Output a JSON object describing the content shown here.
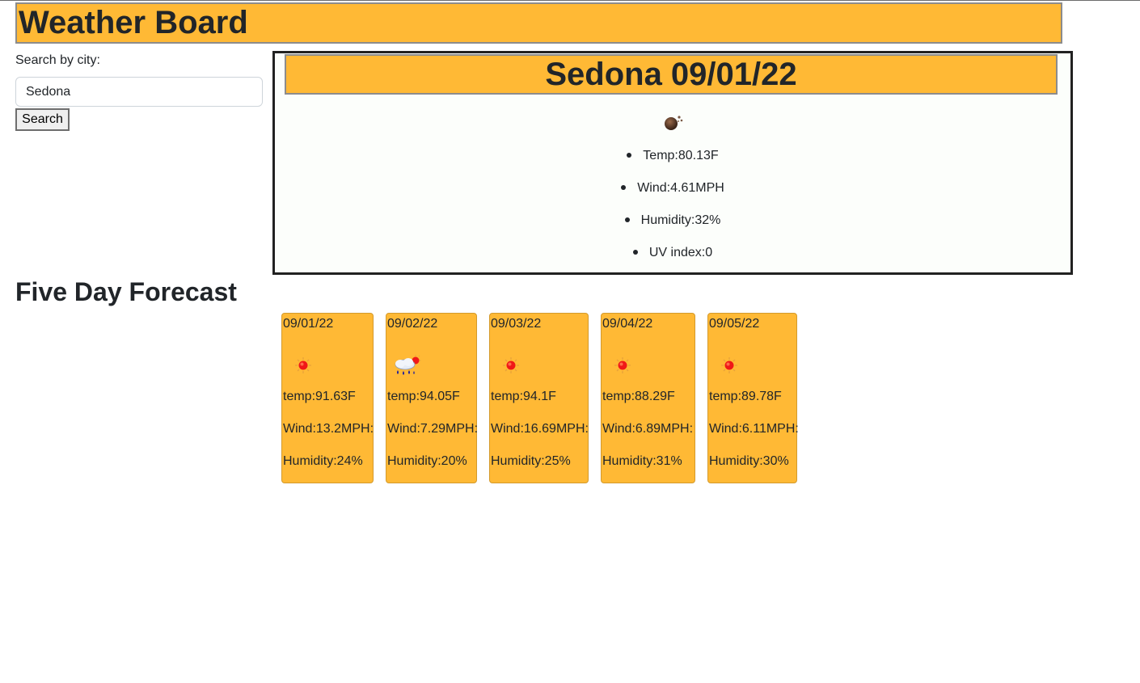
{
  "app": {
    "title": "Weather Board"
  },
  "search": {
    "label": "Search by city:",
    "value": "Sedona",
    "button_label": "Search"
  },
  "current": {
    "title": "Sedona 09/01/22",
    "icon": "smoke-icon",
    "items": [
      {
        "text": "Temp:80.13F"
      },
      {
        "text": "Wind:4.61MPH"
      },
      {
        "text": "Humidity:32%"
      },
      {
        "text": "UV index:0"
      }
    ]
  },
  "forecast": {
    "title": "Five Day Forecast",
    "days": [
      {
        "date": "09/01/22",
        "icon": "sun-icon",
        "temp": "temp:91.63F",
        "wind": "Wind:13.2MPH:",
        "humidity": "Humidity:24%"
      },
      {
        "date": "09/02/22",
        "icon": "rain-cloud-icon",
        "temp": "temp:94.05F",
        "wind": "Wind:7.29MPH:",
        "humidity": "Humidity:20%"
      },
      {
        "date": "09/03/22",
        "icon": "sun-icon",
        "temp": "temp:94.1F",
        "wind": "Wind:16.69MPH:",
        "humidity": "Humidity:25%"
      },
      {
        "date": "09/04/22",
        "icon": "sun-icon",
        "temp": "temp:88.29F",
        "wind": "Wind:6.89MPH:",
        "humidity": "Humidity:31%"
      },
      {
        "date": "09/05/22",
        "icon": "sun-icon",
        "temp": "temp:89.78F",
        "wind": "Wind:6.11MPH:",
        "humidity": "Humidity:30%"
      }
    ]
  },
  "colors": {
    "accent": "#ffb935",
    "text": "#212529",
    "border": "#212121"
  }
}
